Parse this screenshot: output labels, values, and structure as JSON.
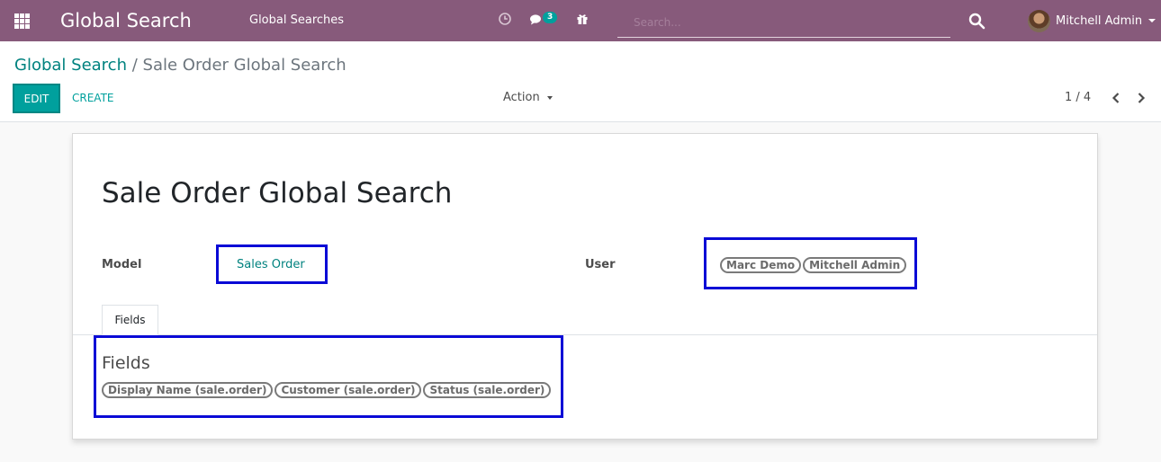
{
  "navbar": {
    "app_title": "Global Search",
    "menu_item": "Global Searches",
    "messages_badge": "3",
    "search_placeholder": "Search...",
    "user_name": "Mitchell Admin",
    "bg_color": "#875a7b"
  },
  "breadcrumb": {
    "parent": "Global Search",
    "separator": "/",
    "current": "Sale Order Global Search"
  },
  "toolbar": {
    "edit_label": "EDIT",
    "create_label": "CREATE",
    "action_label": "Action",
    "pager": "1 / 4",
    "accent_color": "#00a09d"
  },
  "form": {
    "title": "Sale Order Global Search",
    "model_label": "Model",
    "model_value": "Sales Order",
    "user_label": "User",
    "users": [
      "Marc Demo",
      "Mitchell Admin"
    ],
    "tab_label": "Fields",
    "fields_section_title": "Fields",
    "fields": [
      "Display Name (sale.order)",
      "Customer (sale.order)",
      "Status (sale.order)"
    ],
    "highlight_color": "#0a0ad6"
  }
}
